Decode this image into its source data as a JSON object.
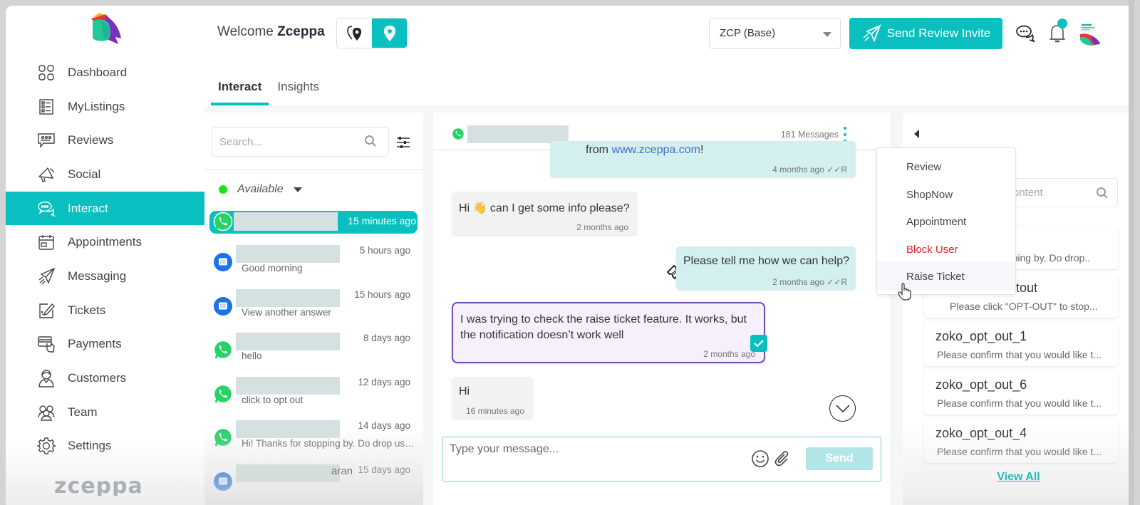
{
  "app": {
    "brand": "zceppa",
    "welcome_prefix": "Welcome",
    "welcome_name": "Zceppa"
  },
  "sidebar": {
    "items": [
      {
        "label": "Dashboard",
        "icon": "grid-icon",
        "active": false
      },
      {
        "label": "MyListings",
        "icon": "list-icon",
        "active": false
      },
      {
        "label": "Reviews",
        "icon": "review-bubble-icon",
        "active": false
      },
      {
        "label": "Social",
        "icon": "megaphone-icon",
        "active": false
      },
      {
        "label": "Interact",
        "icon": "chat-bubbles-icon",
        "active": true
      },
      {
        "label": "Appointments",
        "icon": "calendar-icon",
        "active": false
      },
      {
        "label": "Messaging",
        "icon": "paper-plane-icon",
        "active": false
      },
      {
        "label": "Tickets",
        "icon": "ticket-edit-icon",
        "active": false
      },
      {
        "label": "Payments",
        "icon": "card-hand-icon",
        "active": false
      },
      {
        "label": "Customers",
        "icon": "customer-icon",
        "active": false
      },
      {
        "label": "Team",
        "icon": "team-icon",
        "active": false
      },
      {
        "label": "Settings",
        "icon": "gear-icon",
        "active": false
      }
    ]
  },
  "header": {
    "location_select": "ZCP (Base)",
    "send_review_invite": "Send Review Invite",
    "tabs": [
      {
        "label": "Interact",
        "active": true
      },
      {
        "label": "Insights",
        "active": false
      }
    ]
  },
  "conversations": {
    "search_placeholder": "Search...",
    "availability": "Available",
    "items": [
      {
        "channel": "whatsapp",
        "time": "15 minutes ago",
        "preview": "",
        "active": true,
        "name_fragment": ""
      },
      {
        "channel": "sms",
        "time": "5 hours ago",
        "preview": "Good morning",
        "active": false,
        "name_fragment": ""
      },
      {
        "channel": "sms",
        "time": "15 hours ago",
        "preview": "View another answer",
        "active": false,
        "name_fragment": ""
      },
      {
        "channel": "whatsapp",
        "time": "8 days ago",
        "preview": "hello",
        "active": false,
        "name_fragment": ""
      },
      {
        "channel": "whatsapp",
        "time": "12 days ago",
        "preview": "click to opt out",
        "active": false,
        "name_fragment": ""
      },
      {
        "channel": "whatsapp",
        "time": "14 days ago",
        "preview": "Hi! Thanks for stopping by. Do drop us a …",
        "active": false,
        "name_fragment": ""
      },
      {
        "channel": "sms",
        "time": "15 days ago",
        "preview": "",
        "active": false,
        "name_fragment": "aran"
      }
    ]
  },
  "chat": {
    "message_count": "181 Messages",
    "messages": [
      {
        "direction": "out",
        "text_prefix": "from ",
        "link": "www.zceppa.com",
        "text_suffix": "!",
        "time": "4 months ago",
        "receipt": "R"
      },
      {
        "direction": "in",
        "text": "Hi 👋 can I get some info please?",
        "time": "2 months ago"
      },
      {
        "direction": "out",
        "text": "Please tell me how we can help?",
        "time": "2 months ago",
        "receipt": "R"
      },
      {
        "direction": "in",
        "text": "I was trying to check the raise ticket feature. It works, but the notification doesn’t work well",
        "time": "2 months ago",
        "selected": true
      },
      {
        "direction": "in",
        "text": "Hi",
        "time": "16 minutes ago"
      }
    ],
    "composer_placeholder": "Type your message...",
    "send_label": "Send"
  },
  "chat_menu": {
    "items": [
      {
        "label": "Review",
        "danger": false
      },
      {
        "label": "ShopNow",
        "danger": false
      },
      {
        "label": "Appointment",
        "danger": false
      },
      {
        "label": "Block User",
        "danger": true
      },
      {
        "label": "Raise Ticket",
        "danger": false,
        "hovered": true
      }
    ]
  },
  "templates": {
    "search_placeholder_visible": "ontent",
    "items": [
      {
        "name": "",
        "desc": "opping by. Do drop.."
      },
      {
        "name": "tout",
        "desc": "Please click \"OPT-OUT\" to stop..."
      },
      {
        "name": "zoko_opt_out_1",
        "desc": "Please confirm that you would like t..."
      },
      {
        "name": "zoko_opt_out_6",
        "desc": "Please confirm that you would like t..."
      },
      {
        "name": "zoko_opt_out_4",
        "desc": "Please confirm that you would like t..."
      }
    ],
    "view_all": "View All"
  },
  "colors": {
    "accent": "#0abfbf",
    "danger": "#e0242b",
    "selected_border": "#6a4bb8",
    "available": "#19e619"
  }
}
